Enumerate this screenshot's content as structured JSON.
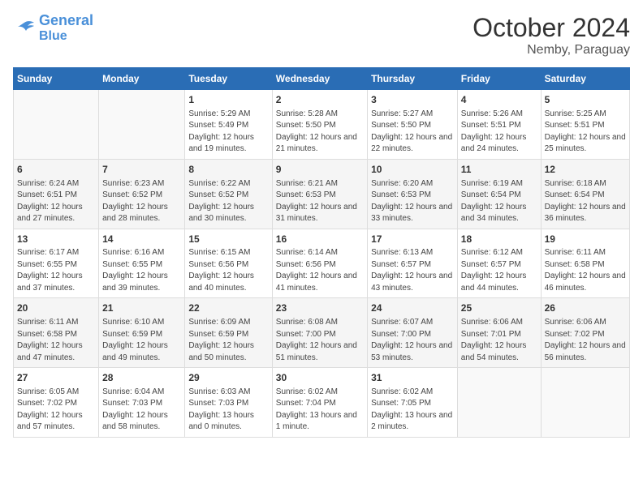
{
  "header": {
    "logo_line1": "General",
    "logo_line2": "Blue",
    "month": "October 2024",
    "location": "Nemby, Paraguay"
  },
  "weekdays": [
    "Sunday",
    "Monday",
    "Tuesday",
    "Wednesday",
    "Thursday",
    "Friday",
    "Saturday"
  ],
  "weeks": [
    [
      {
        "day": "",
        "info": ""
      },
      {
        "day": "",
        "info": ""
      },
      {
        "day": "1",
        "info": "Sunrise: 5:29 AM\nSunset: 5:49 PM\nDaylight: 12 hours and 19 minutes."
      },
      {
        "day": "2",
        "info": "Sunrise: 5:28 AM\nSunset: 5:50 PM\nDaylight: 12 hours and 21 minutes."
      },
      {
        "day": "3",
        "info": "Sunrise: 5:27 AM\nSunset: 5:50 PM\nDaylight: 12 hours and 22 minutes."
      },
      {
        "day": "4",
        "info": "Sunrise: 5:26 AM\nSunset: 5:51 PM\nDaylight: 12 hours and 24 minutes."
      },
      {
        "day": "5",
        "info": "Sunrise: 5:25 AM\nSunset: 5:51 PM\nDaylight: 12 hours and 25 minutes."
      }
    ],
    [
      {
        "day": "6",
        "info": "Sunrise: 6:24 AM\nSunset: 6:51 PM\nDaylight: 12 hours and 27 minutes."
      },
      {
        "day": "7",
        "info": "Sunrise: 6:23 AM\nSunset: 6:52 PM\nDaylight: 12 hours and 28 minutes."
      },
      {
        "day": "8",
        "info": "Sunrise: 6:22 AM\nSunset: 6:52 PM\nDaylight: 12 hours and 30 minutes."
      },
      {
        "day": "9",
        "info": "Sunrise: 6:21 AM\nSunset: 6:53 PM\nDaylight: 12 hours and 31 minutes."
      },
      {
        "day": "10",
        "info": "Sunrise: 6:20 AM\nSunset: 6:53 PM\nDaylight: 12 hours and 33 minutes."
      },
      {
        "day": "11",
        "info": "Sunrise: 6:19 AM\nSunset: 6:54 PM\nDaylight: 12 hours and 34 minutes."
      },
      {
        "day": "12",
        "info": "Sunrise: 6:18 AM\nSunset: 6:54 PM\nDaylight: 12 hours and 36 minutes."
      }
    ],
    [
      {
        "day": "13",
        "info": "Sunrise: 6:17 AM\nSunset: 6:55 PM\nDaylight: 12 hours and 37 minutes."
      },
      {
        "day": "14",
        "info": "Sunrise: 6:16 AM\nSunset: 6:55 PM\nDaylight: 12 hours and 39 minutes."
      },
      {
        "day": "15",
        "info": "Sunrise: 6:15 AM\nSunset: 6:56 PM\nDaylight: 12 hours and 40 minutes."
      },
      {
        "day": "16",
        "info": "Sunrise: 6:14 AM\nSunset: 6:56 PM\nDaylight: 12 hours and 41 minutes."
      },
      {
        "day": "17",
        "info": "Sunrise: 6:13 AM\nSunset: 6:57 PM\nDaylight: 12 hours and 43 minutes."
      },
      {
        "day": "18",
        "info": "Sunrise: 6:12 AM\nSunset: 6:57 PM\nDaylight: 12 hours and 44 minutes."
      },
      {
        "day": "19",
        "info": "Sunrise: 6:11 AM\nSunset: 6:58 PM\nDaylight: 12 hours and 46 minutes."
      }
    ],
    [
      {
        "day": "20",
        "info": "Sunrise: 6:11 AM\nSunset: 6:58 PM\nDaylight: 12 hours and 47 minutes."
      },
      {
        "day": "21",
        "info": "Sunrise: 6:10 AM\nSunset: 6:59 PM\nDaylight: 12 hours and 49 minutes."
      },
      {
        "day": "22",
        "info": "Sunrise: 6:09 AM\nSunset: 6:59 PM\nDaylight: 12 hours and 50 minutes."
      },
      {
        "day": "23",
        "info": "Sunrise: 6:08 AM\nSunset: 7:00 PM\nDaylight: 12 hours and 51 minutes."
      },
      {
        "day": "24",
        "info": "Sunrise: 6:07 AM\nSunset: 7:00 PM\nDaylight: 12 hours and 53 minutes."
      },
      {
        "day": "25",
        "info": "Sunrise: 6:06 AM\nSunset: 7:01 PM\nDaylight: 12 hours and 54 minutes."
      },
      {
        "day": "26",
        "info": "Sunrise: 6:06 AM\nSunset: 7:02 PM\nDaylight: 12 hours and 56 minutes."
      }
    ],
    [
      {
        "day": "27",
        "info": "Sunrise: 6:05 AM\nSunset: 7:02 PM\nDaylight: 12 hours and 57 minutes."
      },
      {
        "day": "28",
        "info": "Sunrise: 6:04 AM\nSunset: 7:03 PM\nDaylight: 12 hours and 58 minutes."
      },
      {
        "day": "29",
        "info": "Sunrise: 6:03 AM\nSunset: 7:03 PM\nDaylight: 13 hours and 0 minutes."
      },
      {
        "day": "30",
        "info": "Sunrise: 6:02 AM\nSunset: 7:04 PM\nDaylight: 13 hours and 1 minute."
      },
      {
        "day": "31",
        "info": "Sunrise: 6:02 AM\nSunset: 7:05 PM\nDaylight: 13 hours and 2 minutes."
      },
      {
        "day": "",
        "info": ""
      },
      {
        "day": "",
        "info": ""
      }
    ]
  ]
}
